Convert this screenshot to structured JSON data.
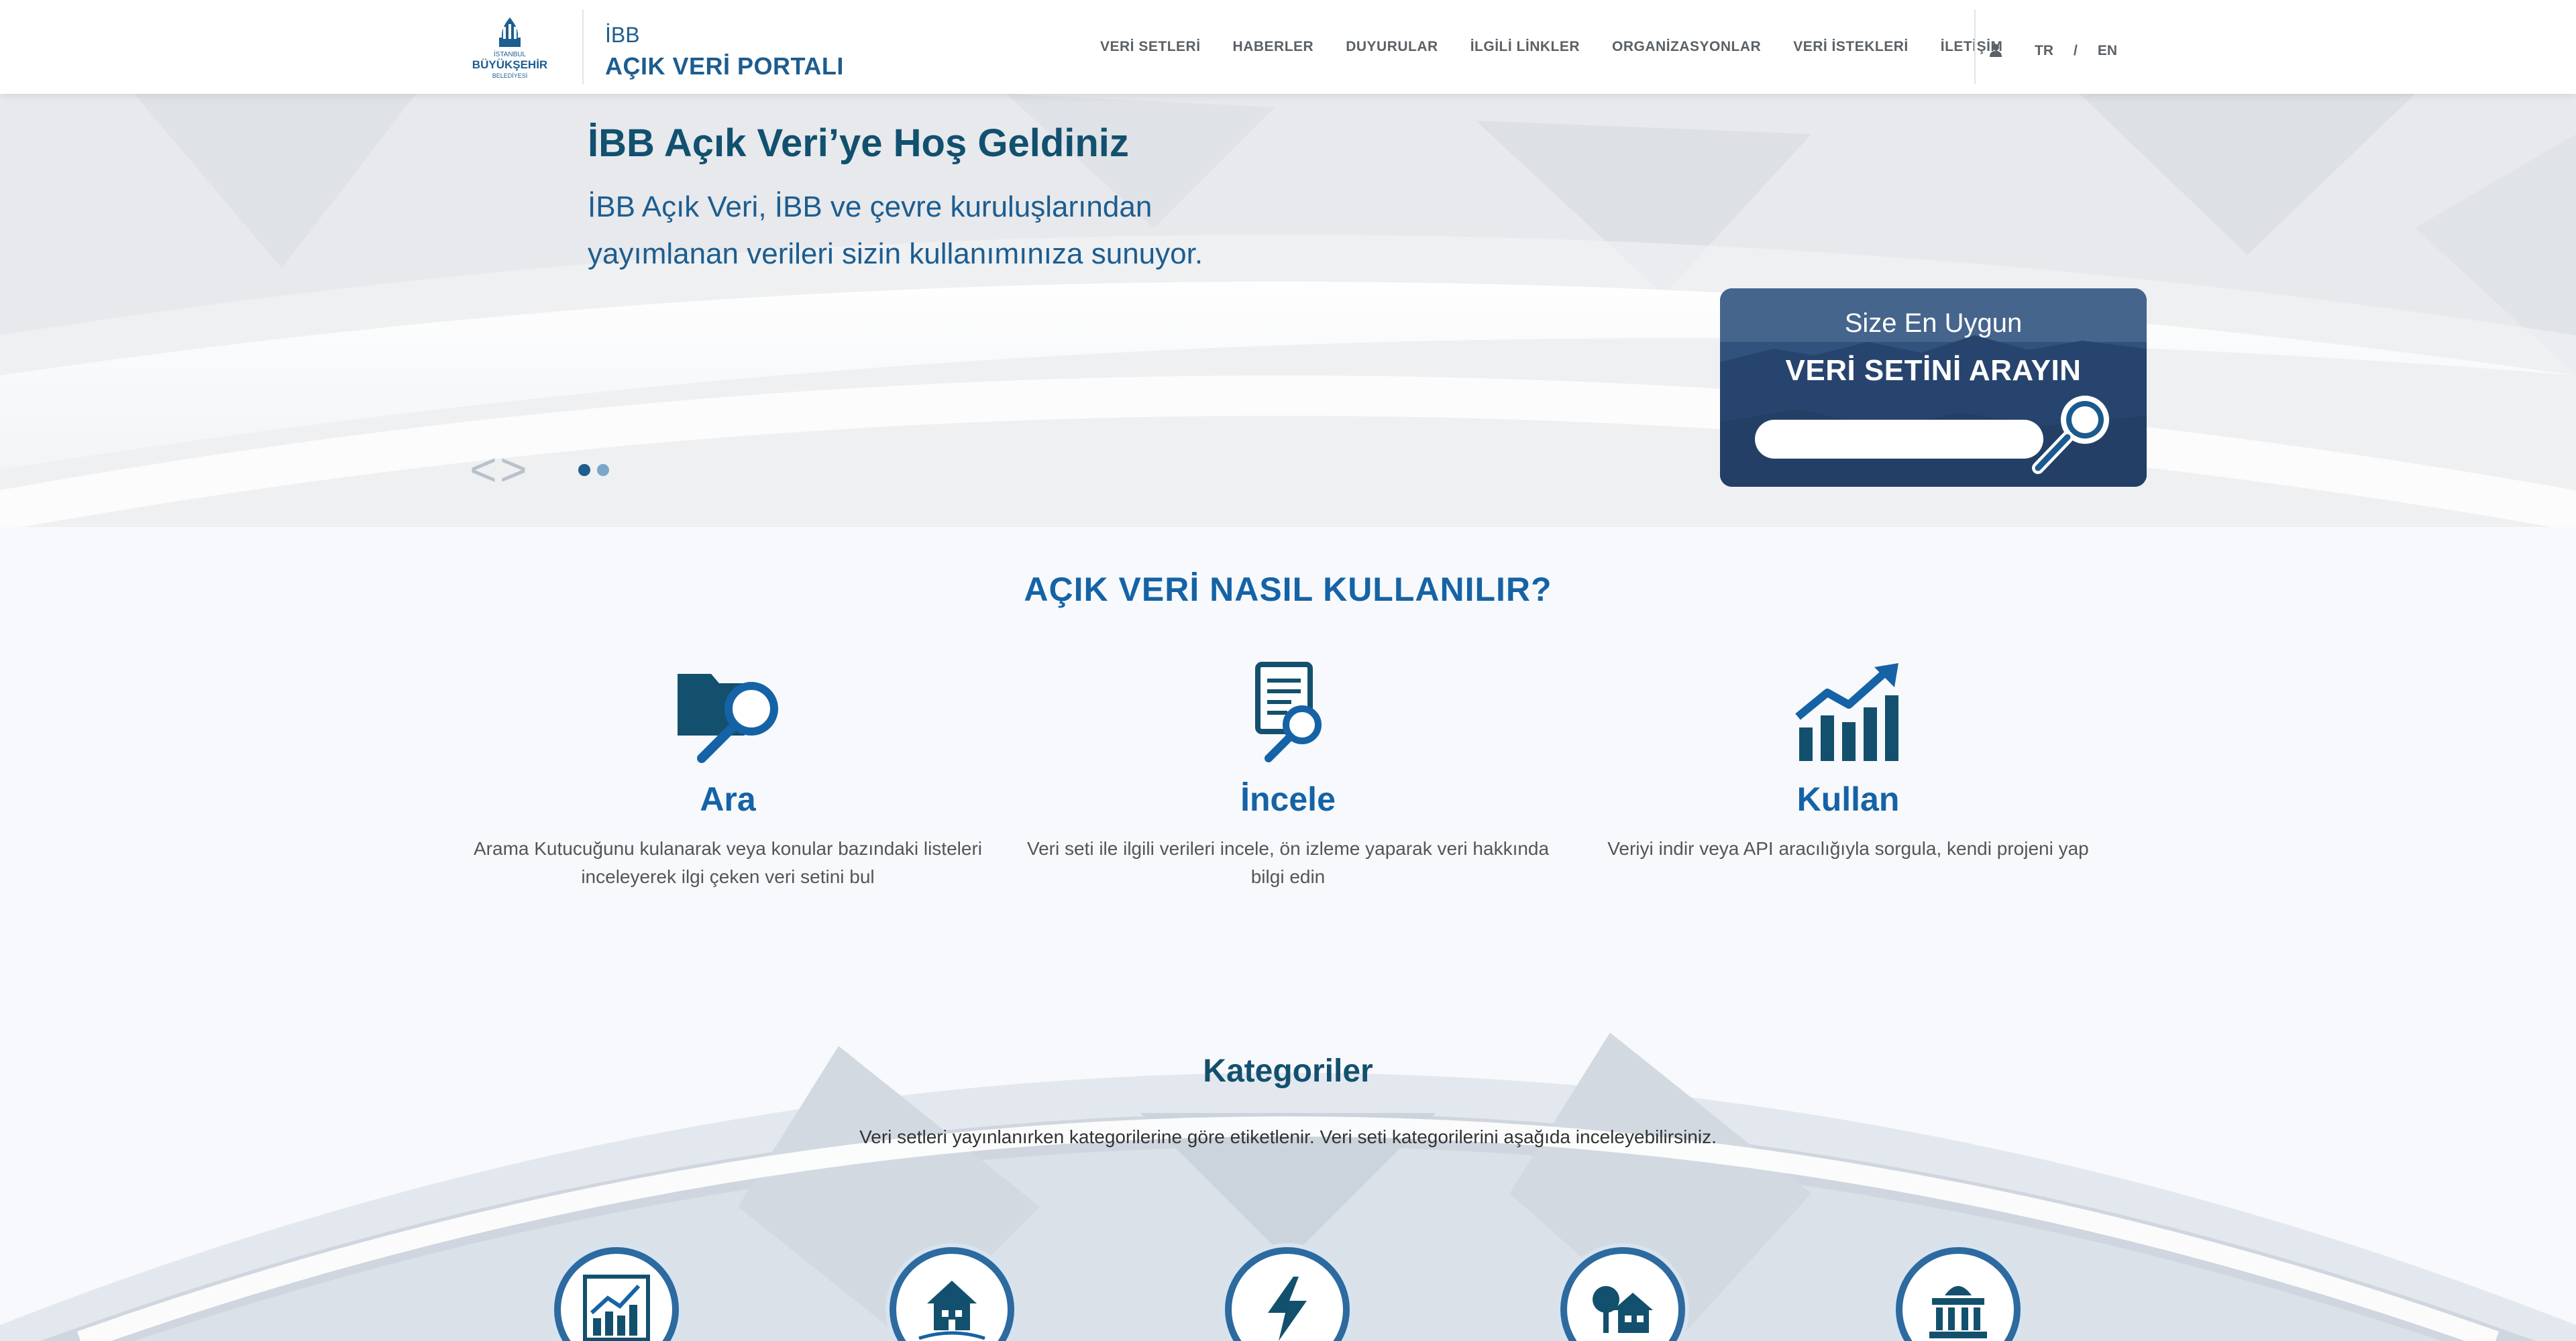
{
  "header": {
    "logo_lines": [
      "İSTANBUL",
      "BÜYÜKŞEHİR",
      "BELEDİYESİ"
    ],
    "brand_top": "İBB",
    "brand_main": "AÇIK VERİ PORTALI",
    "nav": [
      "VERİ SETLERİ",
      "HABERLER",
      "DUYURULAR",
      "İLGİLİ LİNKLER",
      "ORGANİZASYONLAR",
      "VERİ İSTEKLERİ",
      "İLETİŞİM"
    ],
    "lang_tr": "TR",
    "lang_sep": "/",
    "lang_en": "EN"
  },
  "hero": {
    "title": "İBB Açık Veri’ye Hoş Geldiniz",
    "subtitle_line1": "İBB Açık Veri, İBB ve çevre kuruluşlarından",
    "subtitle_line2": "yayımlanan verileri sizin kullanımınıza sunuyor.",
    "arrows": "<>",
    "search_small": "Size En Uygun",
    "search_big": "VERİ SETİNİ ARAYIN",
    "search_placeholder": ""
  },
  "how": {
    "title": "AÇIK VERİ NASIL KULLANILIR?",
    "items": [
      {
        "head": "Ara",
        "text": "Arama Kutucuğunu kulanarak veya konular bazındaki listeleri inceleyerek ilgi çeken veri setini bul"
      },
      {
        "head": "İncele",
        "text": "Veri seti ile ilgili verileri incele, ön izleme yaparak veri hakkında bilgi edin"
      },
      {
        "head": "Kullan",
        "text": "Veriyi indir veya API aracılığıyla sorgula, kendi projeni yap"
      }
    ]
  },
  "categories": {
    "title": "Kategoriler",
    "desc": "Veri setleri yayınlanırken kategorilerine göre etiketlenir. Veri seti kategorilerini aşağıda inceleyebilirsiniz.",
    "icons": [
      "economy-chart-icon",
      "house-icon",
      "energy-bolt-icon",
      "environment-home-icon",
      "government-building-icon"
    ]
  },
  "colors": {
    "primary": "#1563a6",
    "dark": "#11506f",
    "nav_text": "#5b6166"
  }
}
